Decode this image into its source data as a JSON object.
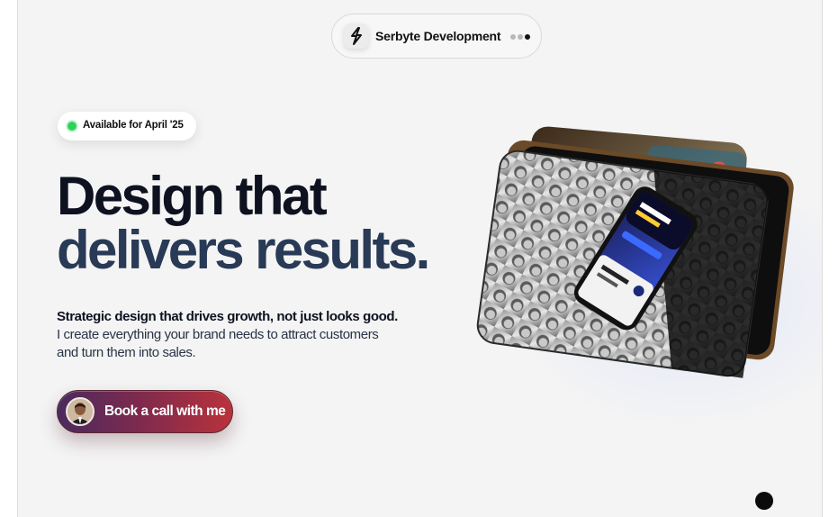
{
  "nav": {
    "brand_name": "Serbyte Development",
    "brand_icon": "lightning-icon",
    "menu_icon": "dots-menu-icon"
  },
  "badge": {
    "text": "Available for April '25",
    "status_color": "#2fd15b"
  },
  "hero": {
    "headline_line1": "Design that",
    "headline_line2": "delivers results.",
    "subtext_bold": "Strategic design that drives growth, not just looks good.",
    "subtext_rest": " I create everything your brand needs to attract customers and turn them into sales.",
    "cta_label": "Book a call with me"
  },
  "colors": {
    "headline_dark": "#0e1220",
    "headline_blue": "#283a55",
    "cta_gradient_start": "#4a2a5e",
    "cta_gradient_end": "#b9323c"
  }
}
